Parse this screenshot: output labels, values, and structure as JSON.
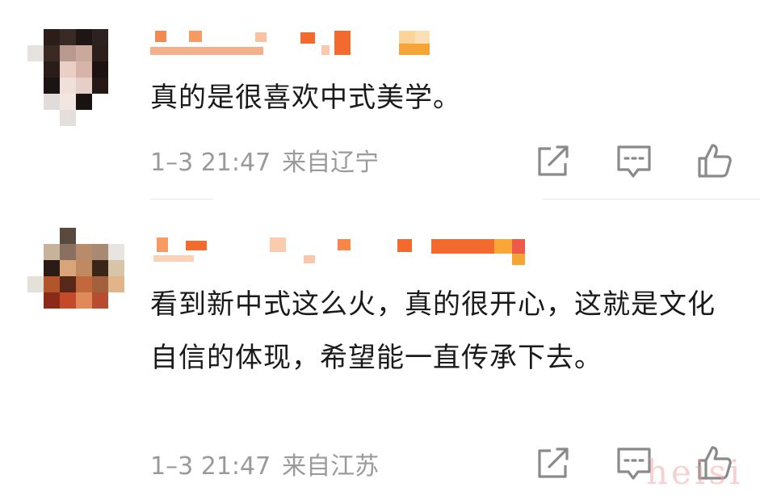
{
  "comments": [
    {
      "text": "真的是很喜欢中式美学。",
      "time": "1–3 21:47",
      "location": "来自辽宁"
    },
    {
      "text": "看到新中式这么火，真的很开心，这就是文化自信的体现，希望能一直传承下去。",
      "time": "1–3 21:47",
      "location": "来自江苏"
    }
  ],
  "icons": {
    "share": "share-icon",
    "reply": "comment-icon",
    "like": "thumbs-up-icon"
  },
  "colors": {
    "text": "#1a1a1a",
    "meta": "#9a9a9a",
    "username_blur": "#f26a2e",
    "icon": "#8a8a8a"
  },
  "watermark": "heisi"
}
